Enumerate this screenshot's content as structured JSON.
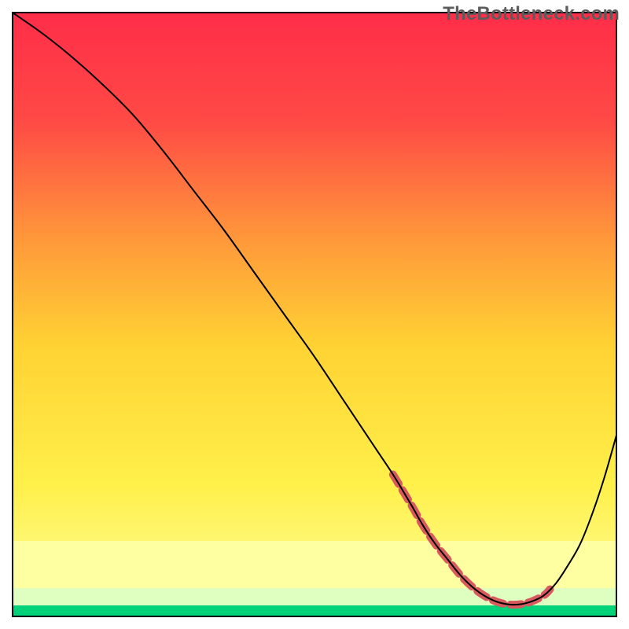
{
  "watermark": "TheBottleneck.com",
  "chart_data": {
    "type": "line",
    "title": "",
    "xlabel": "",
    "ylabel": "",
    "xlim": [
      0,
      100
    ],
    "ylim": [
      0,
      100
    ],
    "background_gradient": {
      "full": {
        "top": "#ff2d49",
        "upper_mid": "#ff7a3c",
        "mid": "#ffd233",
        "lower_mid": "#fff760",
        "bottom": "#00d27a"
      },
      "band_yellow": "#fdffa0",
      "band_green": "#00e57a"
    },
    "series": [
      {
        "name": "bottleneck-curve-smoothed",
        "x": [
          0,
          5,
          10,
          15,
          20,
          25,
          30,
          35,
          40,
          45,
          50,
          55,
          60,
          63,
          66,
          68,
          70,
          72,
          74,
          76,
          78,
          80,
          82,
          84,
          86,
          88,
          90,
          92,
          94,
          96,
          98,
          100
        ],
        "values": [
          100,
          96.5,
          92.5,
          88,
          83,
          77,
          70.5,
          64,
          57,
          50,
          43,
          35.5,
          28,
          23.5,
          18.5,
          15,
          12,
          9.5,
          7,
          5,
          3.5,
          2.5,
          2,
          2,
          2.5,
          3.5,
          5.5,
          8.5,
          12,
          17,
          23,
          30
        ],
        "color": "#000000",
        "stroke_width": 2
      },
      {
        "name": "optimal-zone-marker",
        "x": [
          63,
          66,
          68,
          70,
          72,
          74,
          76,
          78,
          80,
          82,
          84,
          86,
          88,
          89
        ],
        "values": [
          23.5,
          18.5,
          15,
          12,
          9.5,
          7,
          5,
          3.5,
          2.5,
          2,
          2,
          2.5,
          3.5,
          4.5
        ],
        "color": "#d85a5f",
        "stroke_width": 10,
        "dashed": true
      }
    ]
  }
}
